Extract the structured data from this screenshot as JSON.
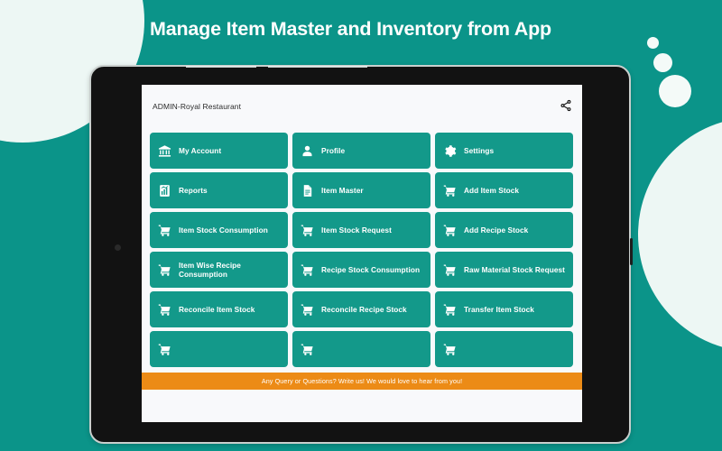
{
  "headline": "Manage Item Master and Inventory from App",
  "app": {
    "title": "ADMIN-Royal Restaurant",
    "share_icon": "share-icon"
  },
  "tiles": [
    {
      "label": "My Account",
      "icon": "bank-icon"
    },
    {
      "label": "Profile",
      "icon": "person-icon"
    },
    {
      "label": "Settings",
      "icon": "gear-icon"
    },
    {
      "label": "Reports",
      "icon": "report-chart-icon"
    },
    {
      "label": "Item Master",
      "icon": "document-icon"
    },
    {
      "label": "Add Item Stock",
      "icon": "cart-icon"
    },
    {
      "label": "Item Stock Consumption",
      "icon": "cart-icon"
    },
    {
      "label": "Item Stock Request",
      "icon": "cart-icon"
    },
    {
      "label": "Add Recipe Stock",
      "icon": "cart-icon"
    },
    {
      "label": "Item Wise Recipe Consumption",
      "icon": "cart-icon"
    },
    {
      "label": "Recipe Stock Consumption",
      "icon": "cart-icon"
    },
    {
      "label": "Raw Material Stock Request",
      "icon": "cart-icon"
    },
    {
      "label": "Reconcile Item Stock",
      "icon": "cart-icon"
    },
    {
      "label": "Reconcile Recipe Stock",
      "icon": "cart-icon"
    },
    {
      "label": "Transfer Item Stock",
      "icon": "cart-icon"
    },
    {
      "label": "",
      "icon": "cart-icon"
    },
    {
      "label": "",
      "icon": "cart-icon"
    },
    {
      "label": "",
      "icon": "cart-icon"
    }
  ],
  "banner": {
    "text": "Any Query or Questions? Write us! We would love to hear from you!"
  },
  "colors": {
    "background_teal": "#0b9489",
    "tile_teal": "#13998a",
    "banner_orange": "#ec8b16",
    "pale_circle": "#edf7f4",
    "screen_bg": "#f8f9fb",
    "device_bezel": "#121212"
  }
}
